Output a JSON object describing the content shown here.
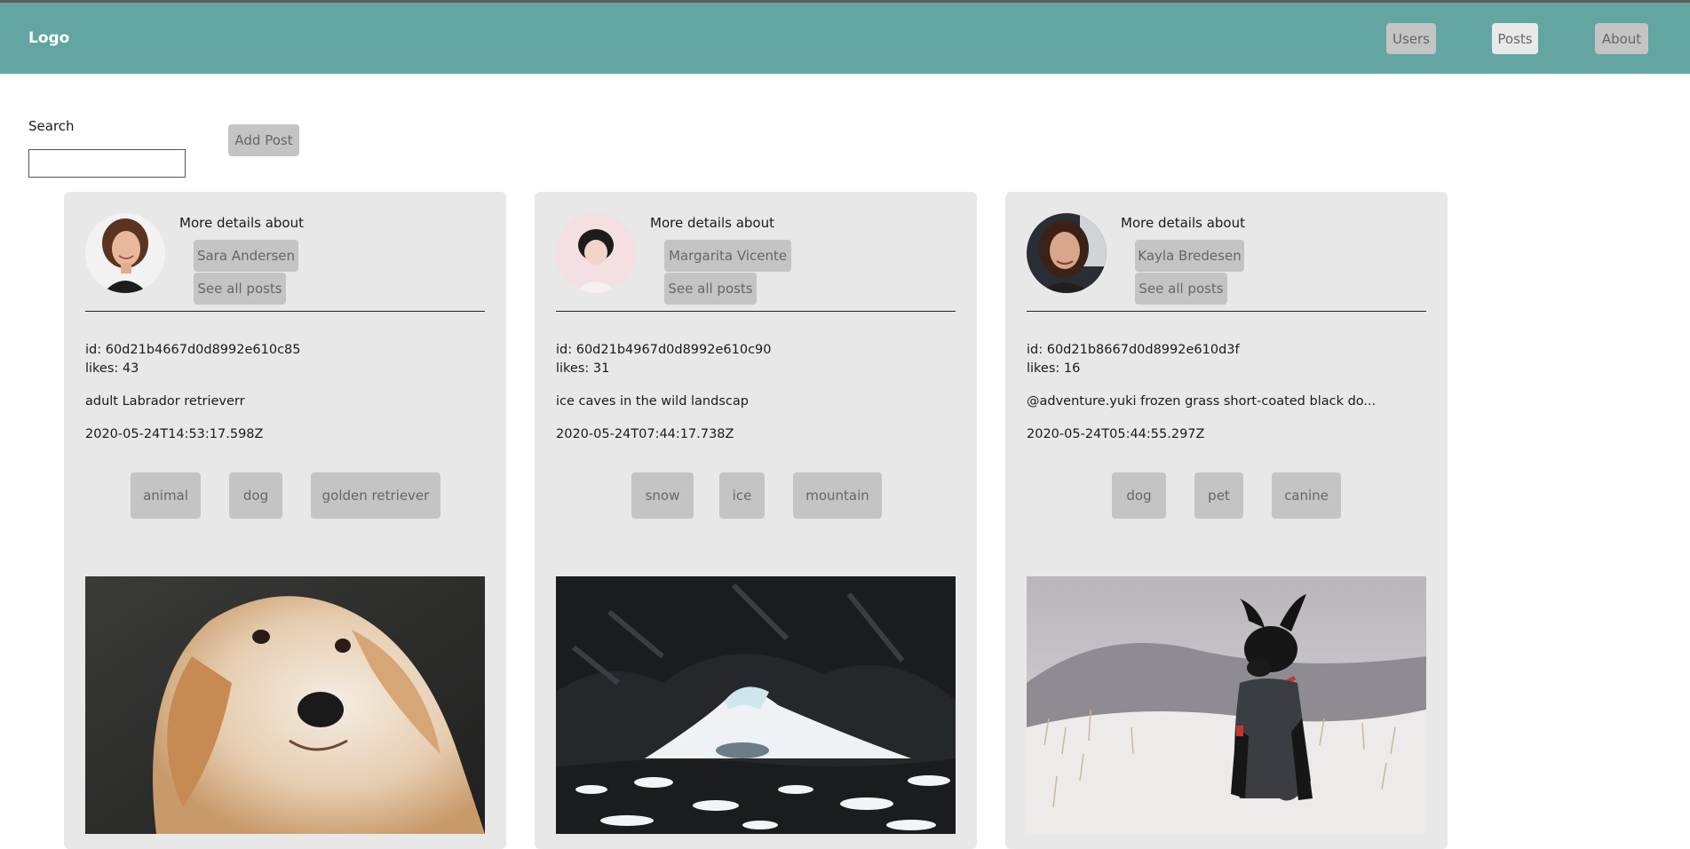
{
  "header": {
    "logo": "Logo",
    "nav": [
      {
        "label": "Users",
        "active": false
      },
      {
        "label": "Posts",
        "active": true
      },
      {
        "label": "About",
        "active": false
      }
    ],
    "colors": {
      "navbar": "#62a5a1",
      "button": "#c4c4c4",
      "active_button": "#e9e9e9"
    }
  },
  "toolbar": {
    "search_label": "Search",
    "search_value": "",
    "add_post_label": "Add Post"
  },
  "posts": [
    {
      "details_label": "More details about",
      "owner": "Sara Andersen",
      "see_all": "See all posts",
      "id_line": "id: 60d21b4667d0d8992e610c85",
      "likes_line": "likes: 43",
      "text": "adult Labrador retrieverr",
      "date": "2020-05-24T14:53:17.598Z",
      "tags": [
        "animal",
        "dog",
        "golden retriever"
      ],
      "image": "golden-retriever-photo"
    },
    {
      "details_label": "More details about",
      "owner": "Margarita Vicente",
      "see_all": "See all posts",
      "id_line": "id: 60d21b4967d0d8992e610c90",
      "likes_line": "likes: 31",
      "text": "ice caves in the wild landscap",
      "date": "2020-05-24T07:44:17.738Z",
      "tags": [
        "snow",
        "ice",
        "mountain"
      ],
      "image": "ice-cave-photo"
    },
    {
      "details_label": "More details about",
      "owner": "Kayla Bredesen",
      "see_all": "See all posts",
      "id_line": "id: 60d21b8667d0d8992e610d3f",
      "likes_line": "likes: 16",
      "text": "@adventure.yuki frozen grass short-coated black do...",
      "date": "2020-05-24T05:44:55.297Z",
      "tags": [
        "dog",
        "pet",
        "canine"
      ],
      "image": "black-dog-photo"
    }
  ]
}
